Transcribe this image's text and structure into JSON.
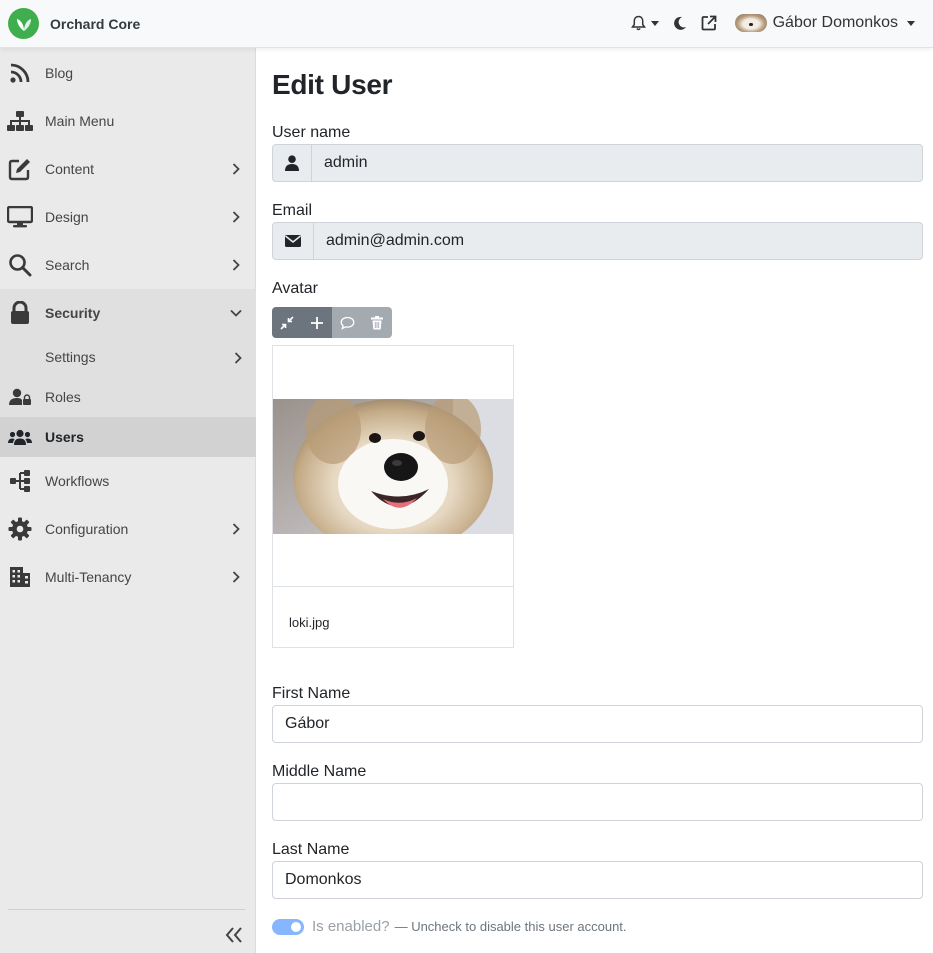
{
  "app": {
    "name": "Orchard Core"
  },
  "topbar": {
    "user_name": "Gábor Domonkos",
    "icons": [
      "bell-icon",
      "moon-icon",
      "external-link-icon"
    ]
  },
  "sidebar": {
    "items": [
      {
        "label": "Blog",
        "icon": "rss-icon"
      },
      {
        "label": "Main Menu",
        "icon": "sitemap-icon"
      },
      {
        "label": "Content",
        "icon": "edit-icon"
      },
      {
        "label": "Design",
        "icon": "desktop-icon"
      },
      {
        "label": "Search",
        "icon": "search-icon"
      },
      {
        "label": "Security",
        "icon": "lock-icon",
        "expanded": true
      },
      {
        "label": "Workflows",
        "icon": "workflow-icon"
      },
      {
        "label": "Configuration",
        "icon": "gear-icon"
      },
      {
        "label": "Multi-Tenancy",
        "icon": "building-icon"
      }
    ],
    "security_children": [
      {
        "label": "Settings"
      },
      {
        "label": "Roles",
        "icon": "user-lock-icon"
      },
      {
        "label": "Users",
        "icon": "users-icon",
        "active": true
      }
    ]
  },
  "page": {
    "title": "Edit User",
    "username": {
      "label": "User name",
      "value": "admin"
    },
    "email": {
      "label": "Email",
      "value": "admin@admin.com"
    },
    "avatar": {
      "label": "Avatar",
      "filename": "loki.jpg"
    },
    "first_name": {
      "label": "First Name",
      "value": "Gábor"
    },
    "middle_name": {
      "label": "Middle Name",
      "value": ""
    },
    "last_name": {
      "label": "Last Name",
      "value": "Domonkos"
    },
    "enabled": {
      "label": "Is enabled?",
      "help": "— Uncheck to disable this user account.",
      "checked": true
    }
  },
  "colors": {
    "brand": "#3fae4f",
    "switch_on": "#86b7fe",
    "toolbar_dark": "#6c757d"
  }
}
